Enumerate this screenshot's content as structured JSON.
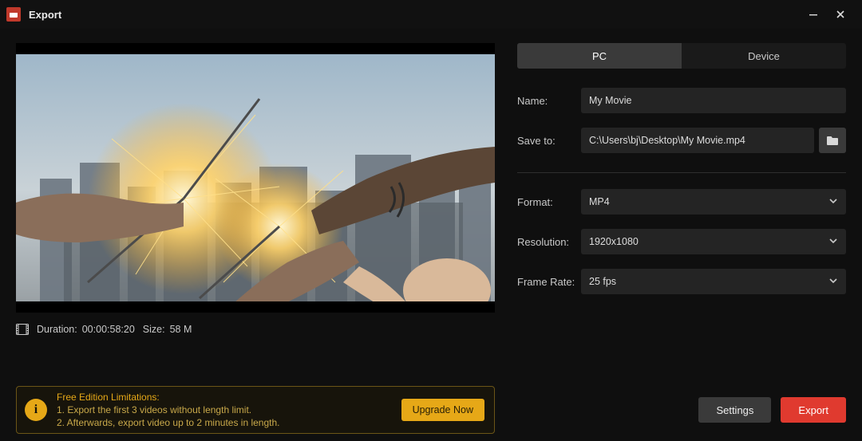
{
  "window": {
    "title": "Export"
  },
  "tabs": {
    "pc": "PC",
    "device": "Device",
    "active": "pc"
  },
  "fields": {
    "name_label": "Name:",
    "name_value": "My Movie",
    "saveto_label": "Save to:",
    "saveto_value": "C:\\Users\\bj\\Desktop\\My Movie.mp4",
    "format_label": "Format:",
    "format_value": "MP4",
    "resolution_label": "Resolution:",
    "resolution_value": "1920x1080",
    "framerate_label": "Frame Rate:",
    "framerate_value": "25 fps"
  },
  "meta": {
    "duration_label": "Duration:",
    "duration_value": "00:00:58:20",
    "size_label": "Size:",
    "size_value": "58 M"
  },
  "limitations": {
    "header": "Free Edition Limitations:",
    "line1": "1. Export the first 3 videos without length limit.",
    "line2": "2. Afterwards, export video up to 2 minutes in length.",
    "upgrade": "Upgrade Now"
  },
  "buttons": {
    "settings": "Settings",
    "export": "Export"
  },
  "icons": {
    "info_glyph": "i"
  }
}
